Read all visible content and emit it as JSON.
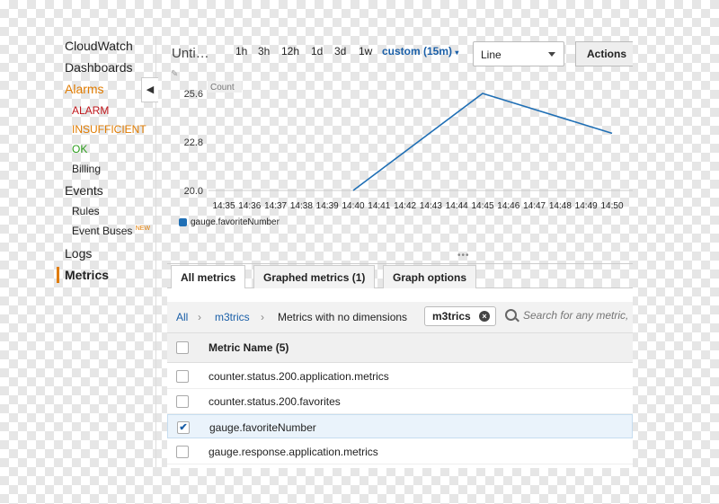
{
  "sidebar": {
    "items": [
      {
        "label": "CloudWatch",
        "color": "#222222"
      },
      {
        "label": "Dashboards",
        "color": "#222222"
      },
      {
        "label": "Alarms",
        "color": "#e07b00"
      },
      {
        "label": "ALARM",
        "color": "#c0161b"
      },
      {
        "label": "INSUFFICIENT",
        "color": "#e07b00"
      },
      {
        "label": "OK",
        "color": "#2a9d1a"
      },
      {
        "label": "Billing",
        "color": "#222222"
      },
      {
        "label": "Events",
        "color": "#222222"
      },
      {
        "label": "Rules",
        "color": "#222222"
      },
      {
        "label": "Event Buses",
        "color": "#222222",
        "badge": "NEW"
      },
      {
        "label": "Logs",
        "color": "#222222"
      },
      {
        "label": "Metrics",
        "color": "#222222",
        "selected": true
      }
    ]
  },
  "toolbar": {
    "title": "Unti…",
    "ranges": [
      "1h",
      "3h",
      "12h",
      "1d",
      "3d",
      "1w"
    ],
    "custom_label": "custom (15m)",
    "chart_type": "Line",
    "actions_label": "Actions"
  },
  "chart_data": {
    "type": "line",
    "ylabel": "Count",
    "yticks": [
      "25.6",
      "22.8",
      "20.0"
    ],
    "ylim": [
      20.0,
      25.6
    ],
    "x": [
      "14:35",
      "14:36",
      "14:37",
      "14:38",
      "14:39",
      "14:40",
      "14:41",
      "14:42",
      "14:43",
      "14:44",
      "14:45",
      "14:46",
      "14:47",
      "14:48",
      "14:49",
      "14:50"
    ],
    "series": [
      {
        "name": "gauge.favoriteNumber",
        "color": "#1f6fb5",
        "points": [
          [
            "14:40",
            20.0
          ],
          [
            "14:45",
            25.6
          ],
          [
            "14:50",
            23.3
          ]
        ]
      }
    ],
    "legend": "bottom-left",
    "grid": false
  },
  "tabs": [
    {
      "label": "All metrics",
      "active": true
    },
    {
      "label": "Graphed metrics (1)",
      "active": false
    },
    {
      "label": "Graph options",
      "active": false
    }
  ],
  "breadcrumb": {
    "all": "All",
    "namespace": "m3trics",
    "dimension": "Metrics with no dimensions"
  },
  "filter_token": "m3trics",
  "search": {
    "placeholder": "Search for any metric, "
  },
  "table": {
    "header": "Metric Name",
    "count": "(5)",
    "rows": [
      {
        "name": "counter.status.200.application.metrics",
        "checked": false
      },
      {
        "name": "counter.status.200.favorites",
        "checked": false
      },
      {
        "name": "gauge.favoriteNumber",
        "checked": true
      },
      {
        "name": "gauge.response.application.metrics",
        "checked": false
      }
    ]
  },
  "colors": {
    "accent": "#e07b00",
    "link": "#1a5fa8",
    "series": "#1f6fb5"
  }
}
